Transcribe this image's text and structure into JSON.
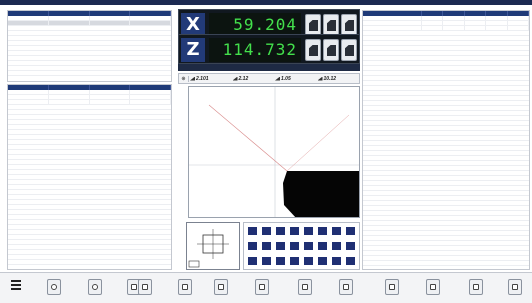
{
  "window": {
    "title": ""
  },
  "left_top_panel": {
    "headers": [
      "",
      "",
      "",
      ""
    ],
    "rows": [
      {
        "cells": [
          "",
          "",
          "",
          ""
        ],
        "selected": false
      },
      {
        "cells": [
          "",
          "",
          "",
          ""
        ],
        "selected": true
      }
    ]
  },
  "left_bottom_panel": {
    "headers": [
      "",
      "",
      "",
      ""
    ],
    "rows": [
      {
        "cells": [
          "",
          "",
          "",
          ""
        ]
      },
      {
        "cells": [
          "",
          "",
          "",
          ""
        ]
      },
      {
        "cells": [
          "",
          "",
          "",
          ""
        ]
      }
    ]
  },
  "dro": {
    "x_axis_label": "X",
    "x_value": "59.204",
    "z_axis_label": "Z",
    "z_value": "114.732"
  },
  "info_bar": {
    "text": ""
  },
  "measurements": {
    "symbol": "⊕",
    "values": [
      "2.101",
      "2.12",
      "1.05",
      "10.12"
    ]
  },
  "right_panel": {
    "headers": [
      "",
      "",
      "",
      "",
      "",
      ""
    ],
    "rows": [
      {
        "cells": [
          "",
          "",
          "",
          "",
          "",
          ""
        ]
      },
      {
        "cells": [
          "",
          "",
          "",
          "",
          "",
          ""
        ]
      },
      {
        "cells": [
          "",
          "",
          "",
          "",
          "",
          ""
        ]
      }
    ]
  },
  "toolbar": {
    "menu_icon": "hamburger-menu-icon",
    "buttons": [
      "record-icon",
      "settings-icon",
      "copy-icon",
      "table-icon",
      "export-icon",
      "document-icon",
      "print-icon",
      "report-icon",
      "measure-icon",
      "clipboard-icon",
      "edit-icon",
      "chart-icon",
      "folder-icon"
    ]
  },
  "colors": {
    "header_blue": "#1f3a78",
    "dro_green": "#43e04c",
    "dro_bg": "#111820",
    "workpiece": "#050505",
    "tool_blue": "#1f2f73"
  }
}
